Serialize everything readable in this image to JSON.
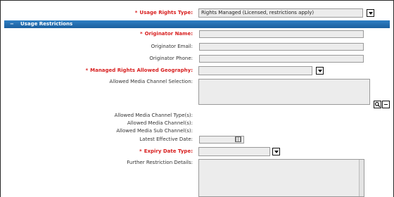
{
  "usage_rights": {
    "label": "Usage Rights Type:",
    "value": "Rights Managed (Licensed, restrictions apply)"
  },
  "section": {
    "title": "Usage Restrictions",
    "collapse_symbol": "−"
  },
  "fields": {
    "originator_name": {
      "label": "Originator Name:",
      "value": ""
    },
    "originator_email": {
      "label": "Originator Email:",
      "value": ""
    },
    "originator_phone": {
      "label": "Originator Phone:",
      "value": ""
    },
    "managed_geo": {
      "label": "Managed Rights Allowed Geography:",
      "value": ""
    },
    "media_channel_selection": {
      "label": "Allowed Media Channel Selection:"
    },
    "media_channel_types": {
      "label": "Allowed Media Channel Type(s):"
    },
    "media_channels": {
      "label": "Allowed Media Channel(s):"
    },
    "media_sub_channels": {
      "label": "Allowed Media Sub Channel(s):"
    },
    "latest_effective_date": {
      "label": "Latest Effective Date:",
      "value": ""
    },
    "expiry_date_type": {
      "label": "Expiry Date Type:",
      "value": ""
    },
    "further_restriction": {
      "label": "Further Restriction Details:"
    }
  },
  "required_marker": "*",
  "icons": {
    "search": "search-icon",
    "remove": "minus-icon",
    "calendar": "calendar-icon",
    "dropdown": "chevron-down-icon"
  }
}
